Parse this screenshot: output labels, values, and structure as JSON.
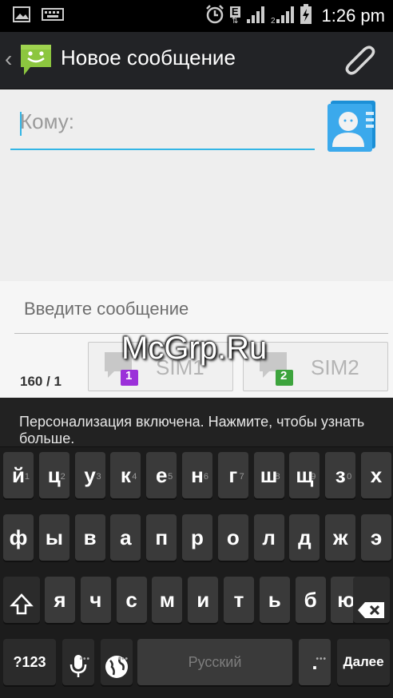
{
  "status_bar": {
    "time": "1:26 pm",
    "network_label": "E"
  },
  "action_bar": {
    "title": "Новое сообщение"
  },
  "recipient": {
    "placeholder": "Кому:"
  },
  "compose": {
    "placeholder": "Введите сообщение",
    "counter": "160 / 1",
    "sim1_label": "SIM1",
    "sim2_label": "SIM2",
    "sim1_badge": "1",
    "sim2_badge": "2"
  },
  "watermark": "McGrp.Ru",
  "keyboard": {
    "suggestion": "Персонализация включена. Нажмите, чтобы узнать больше.",
    "row1": [
      {
        "label": "й",
        "hint": "1"
      },
      {
        "label": "ц",
        "hint": "2"
      },
      {
        "label": "у",
        "hint": "3"
      },
      {
        "label": "к",
        "hint": "4"
      },
      {
        "label": "е",
        "hint": "5"
      },
      {
        "label": "н",
        "hint": "6"
      },
      {
        "label": "г",
        "hint": "7"
      },
      {
        "label": "ш",
        "hint": "8"
      },
      {
        "label": "щ",
        "hint": "9"
      },
      {
        "label": "з",
        "hint": "0"
      },
      {
        "label": "х",
        "hint": ""
      }
    ],
    "row2": [
      "ф",
      "ы",
      "в",
      "а",
      "п",
      "р",
      "о",
      "л",
      "д",
      "ж",
      "э"
    ],
    "row3": [
      "я",
      "ч",
      "с",
      "м",
      "и",
      "т",
      "ь",
      "б",
      "ю"
    ],
    "mode_label": "?123",
    "space_label": "Русский",
    "period_label": ".",
    "enter_label": "Далее",
    "colors": {
      "key": "#3a3a3a",
      "accent": "#33b5e5"
    }
  }
}
